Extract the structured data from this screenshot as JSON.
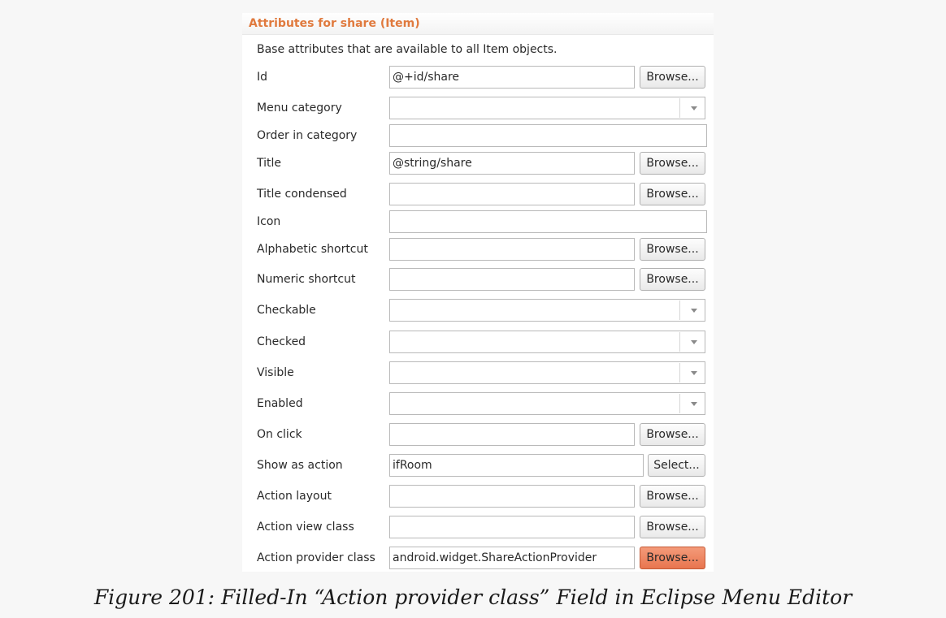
{
  "panel": {
    "title": "Attributes for share (Item)",
    "description": "Base attributes that are available to all Item objects."
  },
  "rows": {
    "id": {
      "label": "Id",
      "value": "@+id/share",
      "button": "Browse..."
    },
    "menu_category": {
      "label": "Menu category",
      "value": ""
    },
    "order_in_category": {
      "label": "Order in category",
      "value": ""
    },
    "title": {
      "label": "Title",
      "value": "@string/share",
      "button": "Browse..."
    },
    "title_condensed": {
      "label": "Title condensed",
      "value": "",
      "button": "Browse..."
    },
    "icon": {
      "label": "Icon",
      "value": ""
    },
    "alphabetic_shortcut": {
      "label": "Alphabetic shortcut",
      "value": "",
      "button": "Browse..."
    },
    "numeric_shortcut": {
      "label": "Numeric shortcut",
      "value": "",
      "button": "Browse..."
    },
    "checkable": {
      "label": "Checkable",
      "value": ""
    },
    "checked": {
      "label": "Checked",
      "value": ""
    },
    "visible": {
      "label": "Visible",
      "value": ""
    },
    "enabled": {
      "label": "Enabled",
      "value": ""
    },
    "on_click": {
      "label": "On click",
      "value": "",
      "button": "Browse..."
    },
    "show_as_action": {
      "label": "Show as action",
      "value": "ifRoom",
      "button": "Select..."
    },
    "action_layout": {
      "label": "Action layout",
      "value": "",
      "button": "Browse..."
    },
    "action_view_class": {
      "label": "Action view class",
      "value": "",
      "button": "Browse..."
    },
    "action_provider_class": {
      "label": "Action provider class",
      "value": "android.widget.ShareActionProvider",
      "button": "Browse..."
    }
  },
  "caption": "Figure 201: Filled-In “Action provider class” Field in Eclipse Menu Editor",
  "colors": {
    "header_text": "#e07a3e",
    "focused_button": "#e8754f"
  }
}
